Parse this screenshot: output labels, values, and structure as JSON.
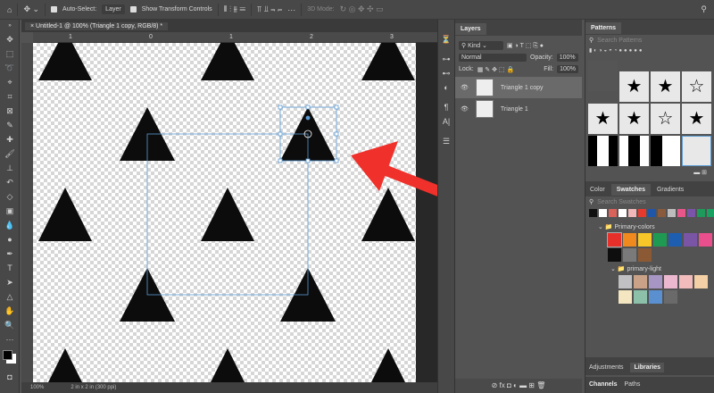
{
  "options_bar": {
    "auto_select_label": "Auto-Select:",
    "auto_select_value": "Layer",
    "show_transform_label": "Show Transform Controls",
    "mode_3d": "3D Mode:"
  },
  "document": {
    "tab_title": "Untitled-1 @ 100% (Triangle 1 copy, RGB/8) *",
    "ruler_ticks": [
      "1",
      "0",
      "1",
      "2",
      "3"
    ],
    "zoom": "100%",
    "doc_size": "2 in x 2 in (300 ppi)"
  },
  "layers_panel": {
    "tab": "Layers",
    "filter_kind": "Kind",
    "blend_mode": "Normal",
    "opacity_label": "Opacity:",
    "opacity": "100%",
    "lock_label": "Lock:",
    "fill_label": "Fill:",
    "fill": "100%",
    "layers": [
      {
        "name": "Triangle 1 copy",
        "selected": true
      },
      {
        "name": "Triangle 1",
        "selected": false
      }
    ]
  },
  "patterns_panel": {
    "tab": "Patterns",
    "search_placeholder": "Search Patterns"
  },
  "swatches_panel": {
    "tabs": [
      "Color",
      "Swatches",
      "Gradients"
    ],
    "active_tab": "Swatches",
    "search_placeholder": "Search Swatches",
    "recent": [
      "#111111",
      "#ffffff",
      "#d9625a",
      "#ffffff",
      "#f0b8b8",
      "#e63a2e",
      "#1f56a8",
      "#8a5a3c",
      "#bdbdbd",
      "#e8568a",
      "#7a54a8",
      "#1e9a5a",
      "#1aa060"
    ],
    "groups": [
      {
        "name": "Primary-colors",
        "colors": [
          "#e8302a",
          "#f08a1e",
          "#f7c628",
          "#1f9a52",
          "#1e5eb0",
          "#7a55a6",
          "#e84f8c",
          "#0e0e0e",
          "#7a7a7a",
          "#8b5a35"
        ]
      },
      {
        "name": "primary-light",
        "colors": [
          "#c0bfc2",
          "#c9a288",
          "#a795c4",
          "#ecb8d0",
          "#f2bcbc",
          "#f5cfa6",
          "#f3e6c0",
          "#8cc0a8",
          "#5a8fd0",
          "#6a6a6a"
        ]
      }
    ]
  },
  "bottom_tabs": {
    "row1": [
      "Adjustments",
      "Libraries"
    ],
    "row2": [
      "Channels",
      "Paths"
    ]
  },
  "colors": {
    "arrow": "#f0302a",
    "selection": "#5b9bd5"
  }
}
